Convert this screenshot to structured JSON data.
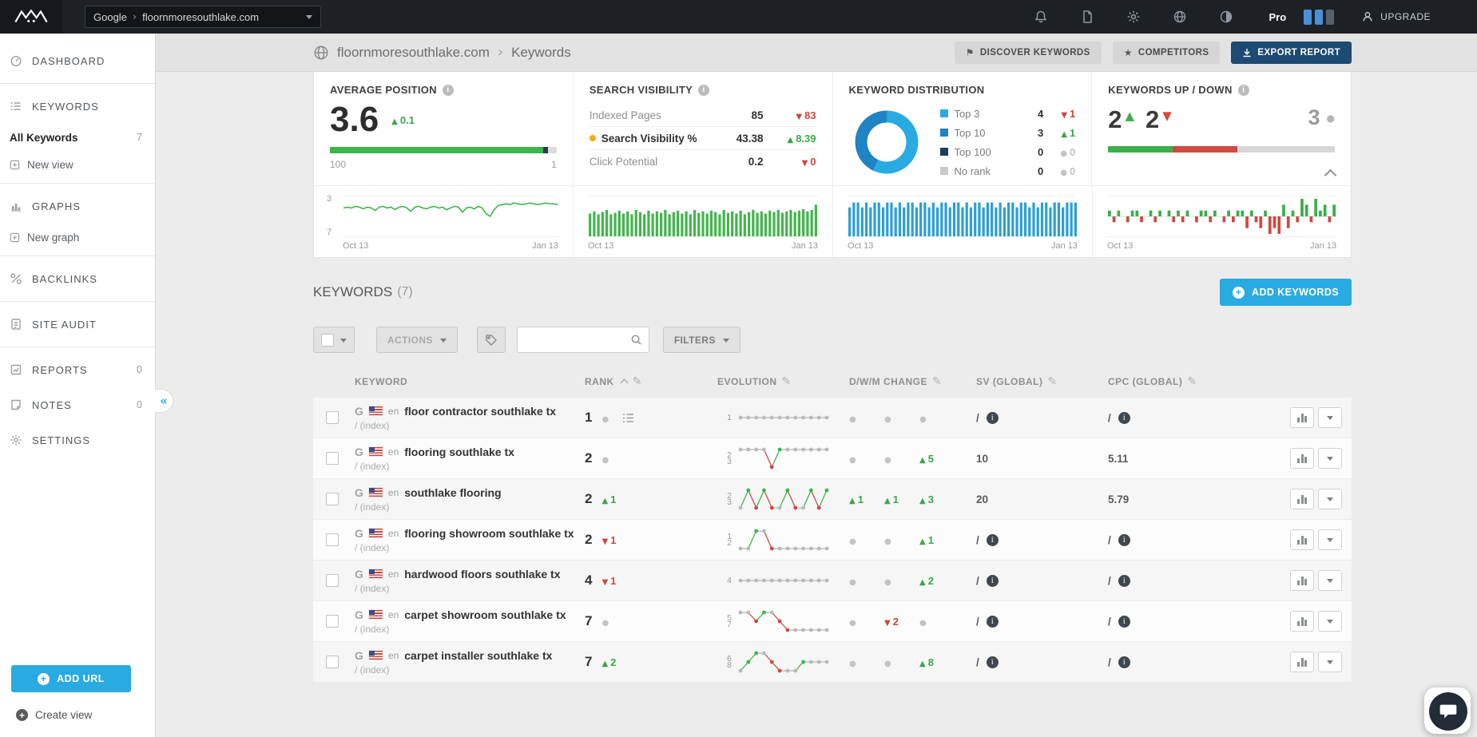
{
  "topbar": {
    "selector_prefix": "Google",
    "selector_separator": "›",
    "selector_site": "floornmoresouthlake.com",
    "plan": "Pro",
    "upgrade": "UPGRADE"
  },
  "sidebar": {
    "dashboard": "DASHBOARD",
    "keywords": "KEYWORDS",
    "all_keywords": "All Keywords",
    "all_keywords_count": "7",
    "new_view": "New view",
    "graphs": "GRAPHS",
    "new_graph": "New graph",
    "backlinks": "BACKLINKS",
    "site_audit": "SITE AUDIT",
    "reports": "REPORTS",
    "reports_count": "0",
    "notes": "NOTES",
    "notes_count": "0",
    "settings": "SETTINGS",
    "collapse": "«",
    "add_url": "ADD URL",
    "create_view": "Create view"
  },
  "header": {
    "site": "floornmoresouthlake.com",
    "separator": "›",
    "section": "Keywords",
    "discover": "DISCOVER KEYWORDS",
    "competitors": "COMPETITORS",
    "export": "EXPORT REPORT"
  },
  "stats": {
    "avg_position": {
      "title": "AVERAGE POSITION",
      "value": "3.6",
      "change_dir": "up",
      "change": "0.1",
      "bar_pct": 94,
      "scale_left": "100",
      "scale_right": "1"
    },
    "search_visibility": {
      "title": "SEARCH VISIBILITY",
      "rows": [
        {
          "label": "Indexed Pages",
          "value": "85",
          "dir": "down",
          "change": "83",
          "active": false
        },
        {
          "label": "Search Visibility %",
          "value": "43.38",
          "dir": "up",
          "change": "8.39",
          "active": true
        },
        {
          "label": "Click Potential",
          "value": "0.2",
          "dir": "down",
          "change": "0",
          "active": false
        }
      ]
    },
    "distribution": {
      "title": "KEYWORD DISTRIBUTION",
      "legend": [
        {
          "label": "Top 3",
          "value": "4",
          "dir": "down",
          "change": "1",
          "color": "#29abe2"
        },
        {
          "label": "Top 10",
          "value": "3",
          "dir": "up",
          "change": "1",
          "color": "#1f83c4"
        },
        {
          "label": "Top 100",
          "value": "0",
          "dir": "none",
          "change": "0",
          "color": "#1d4057"
        },
        {
          "label": "No rank",
          "value": "0",
          "dir": "none",
          "change": "0",
          "color": "#c9c9c9"
        }
      ]
    },
    "updown": {
      "title": "KEYWORDS UP / DOWN",
      "up_count": "2",
      "down_count": "2",
      "same_count": "3",
      "bar_up_pct": 28.5,
      "bar_down_pct": 28.5
    }
  },
  "charts": {
    "avg_position_spark": {
      "type": "line",
      "label_top": "3",
      "label_bottom": "7",
      "x_start": "Oct 13",
      "x_end": "Jan 13",
      "min": 3,
      "max": 7,
      "color": "#3cb54a",
      "values": [
        4.0,
        3.9,
        4.0,
        3.8,
        3.9,
        4.1,
        3.9,
        4.0,
        4.3,
        3.9,
        3.8,
        4.0,
        3.9,
        4.2,
        3.9,
        3.8,
        4.0,
        4.4,
        3.9,
        3.8,
        4.0,
        4.1,
        3.9,
        3.8,
        4.0,
        3.9,
        4.2,
        4.0,
        3.8,
        3.9,
        4.5,
        4.0,
        3.9,
        4.1,
        3.8,
        4.0,
        4.7,
        5.0,
        4.2,
        3.7,
        3.6,
        3.5,
        3.6,
        3.4,
        3.5,
        3.6,
        3.5,
        3.4,
        3.5,
        3.6,
        3.5,
        3.4,
        3.5,
        3.5,
        3.6
      ]
    },
    "visibility_spark": {
      "type": "bar",
      "x_start": "Oct 13",
      "x_end": "Jan 13",
      "max": 50,
      "color": "#44b54e",
      "values": [
        31,
        34,
        30,
        33,
        36,
        30,
        32,
        35,
        31,
        34,
        30,
        36,
        33,
        30,
        35,
        31,
        34,
        32,
        36,
        30,
        33,
        35,
        31,
        34,
        30,
        36,
        32,
        34,
        31,
        35,
        33,
        30,
        36,
        32,
        34,
        31,
        35,
        30,
        33,
        36,
        32,
        34,
        31,
        35,
        33,
        36,
        32,
        34,
        36,
        33,
        35,
        37,
        34,
        36,
        43
      ]
    },
    "distribution_spark": {
      "type": "bar",
      "x_start": "Oct 13",
      "x_end": "Jan 13",
      "max": 7.6,
      "color": "#2d9fd6",
      "values": [
        6,
        7,
        7,
        6,
        7,
        6,
        7,
        7,
        6,
        7,
        7,
        6,
        7,
        6,
        7,
        7,
        6,
        7,
        7,
        6,
        7,
        6,
        7,
        7,
        6,
        7,
        7,
        6,
        7,
        6,
        7,
        7,
        6,
        7,
        7,
        6,
        7,
        6,
        7,
        7,
        6,
        7,
        7,
        6,
        7,
        6,
        7,
        7,
        6,
        7,
        7,
        6,
        7,
        7,
        7
      ]
    },
    "updown_spark": {
      "type": "bar",
      "x_start": "Oct 13",
      "x_end": "Jan 13",
      "max": 3,
      "color_up": "#3aaf4c",
      "color_down": "#cf4a40",
      "values": [
        1,
        -1,
        1,
        0,
        -1,
        1,
        1,
        -1,
        0,
        1,
        -1,
        1,
        0,
        1,
        -1,
        1,
        -1,
        1,
        0,
        -1,
        1,
        1,
        -1,
        1,
        0,
        -1,
        1,
        -1,
        1,
        1,
        -2,
        1,
        -1,
        -2,
        1,
        -3,
        -2,
        -3,
        2,
        -2,
        1,
        -1,
        3,
        2,
        -1,
        3,
        1,
        2,
        -1,
        2
      ]
    }
  },
  "keywords_section": {
    "title": "KEYWORDS",
    "count": "(7)",
    "add_button": "ADD KEYWORDS",
    "actions": "ACTIONS",
    "filters": "FILTERS",
    "search_placeholder": ""
  },
  "table": {
    "headers": {
      "keyword": "KEYWORD",
      "rank": "RANK",
      "evolution": "EVOLUTION",
      "dwm": "D/W/M CHANGE",
      "sv": "SV (GLOBAL)",
      "cpc": "CPC (GLOBAL)"
    },
    "rows": [
      {
        "engine": "G",
        "lang": "en",
        "keyword": "floor contractor southlake tx",
        "path": "/ (index)",
        "rank": "1",
        "rank_dir": "none",
        "rank_change": "",
        "serp_icon": true,
        "evo": {
          "label_top": "",
          "label_mid": "1",
          "label_bottom": "",
          "values": [
            1,
            1,
            1,
            1,
            1,
            1,
            1,
            1,
            1,
            1,
            1,
            1
          ]
        },
        "dwm": [
          {
            "dir": "none",
            "value": ""
          },
          {
            "dir": "none",
            "value": ""
          },
          {
            "dir": "none",
            "value": ""
          }
        ],
        "sv": "/",
        "sv_info": true,
        "cpc": "/",
        "cpc_info": true
      },
      {
        "engine": "G",
        "lang": "en",
        "keyword": "flooring southlake tx",
        "path": "/ (index)",
        "rank": "2",
        "rank_dir": "none",
        "rank_change": "",
        "serp_icon": false,
        "evo": {
          "label_top": "2",
          "label_mid": "",
          "label_bottom": "3",
          "values": [
            2,
            2,
            2,
            2,
            3,
            2,
            2,
            2,
            2,
            2,
            2,
            2
          ]
        },
        "dwm": [
          {
            "dir": "none",
            "value": ""
          },
          {
            "dir": "none",
            "value": ""
          },
          {
            "dir": "up",
            "value": "5"
          }
        ],
        "sv": "10",
        "sv_info": false,
        "cpc": "5.11",
        "cpc_info": false
      },
      {
        "engine": "G",
        "lang": "en",
        "keyword": "southlake flooring",
        "path": "/ (index)",
        "rank": "2",
        "rank_dir": "up",
        "rank_change": "1",
        "serp_icon": false,
        "evo": {
          "label_top": "2",
          "label_mid": "",
          "label_bottom": "3",
          "values": [
            3,
            2,
            3,
            2,
            3,
            3,
            2,
            3,
            3,
            2,
            3,
            2
          ]
        },
        "dwm": [
          {
            "dir": "up",
            "value": "1"
          },
          {
            "dir": "up",
            "value": "1"
          },
          {
            "dir": "up",
            "value": "3"
          }
        ],
        "sv": "20",
        "sv_info": false,
        "cpc": "5.79",
        "cpc_info": false
      },
      {
        "engine": "G",
        "lang": "en",
        "keyword": "flooring showroom southlake tx",
        "path": "/ (index)",
        "rank": "2",
        "rank_dir": "down",
        "rank_change": "1",
        "serp_icon": false,
        "evo": {
          "label_top": "1",
          "label_mid": "",
          "label_bottom": "2",
          "values": [
            2,
            2,
            1,
            1,
            2,
            2,
            2,
            2,
            2,
            2,
            2,
            2
          ]
        },
        "dwm": [
          {
            "dir": "none",
            "value": ""
          },
          {
            "dir": "none",
            "value": ""
          },
          {
            "dir": "up",
            "value": "1"
          }
        ],
        "sv": "/",
        "sv_info": true,
        "cpc": "/",
        "cpc_info": true
      },
      {
        "engine": "G",
        "lang": "en",
        "keyword": "hardwood floors southlake tx",
        "path": "/ (index)",
        "rank": "4",
        "rank_dir": "down",
        "rank_change": "1",
        "serp_icon": false,
        "evo": {
          "label_top": "",
          "label_mid": "4",
          "label_bottom": "",
          "values": [
            4,
            4,
            4,
            4,
            4,
            4,
            4,
            4,
            4,
            4,
            4,
            4
          ]
        },
        "dwm": [
          {
            "dir": "none",
            "value": ""
          },
          {
            "dir": "none",
            "value": ""
          },
          {
            "dir": "up",
            "value": "2"
          }
        ],
        "sv": "/",
        "sv_info": true,
        "cpc": "/",
        "cpc_info": true
      },
      {
        "engine": "G",
        "lang": "en",
        "keyword": "carpet showroom southlake tx",
        "path": "/ (index)",
        "rank": "7",
        "rank_dir": "none",
        "rank_change": "",
        "serp_icon": false,
        "evo": {
          "label_top": "5",
          "label_mid": "",
          "label_bottom": "7",
          "values": [
            5,
            5,
            6,
            5,
            5,
            6,
            7,
            7,
            7,
            7,
            7,
            7
          ]
        },
        "dwm": [
          {
            "dir": "none",
            "value": ""
          },
          {
            "dir": "down",
            "value": "2"
          },
          {
            "dir": "none",
            "value": ""
          }
        ],
        "sv": "/",
        "sv_info": true,
        "cpc": "/",
        "cpc_info": true
      },
      {
        "engine": "G",
        "lang": "en",
        "keyword": "carpet installer southlake tx",
        "path": "/ (index)",
        "rank": "7",
        "rank_dir": "up",
        "rank_change": "2",
        "serp_icon": false,
        "evo": {
          "label_top": "6",
          "label_mid": "",
          "label_bottom": "8",
          "values": [
            8,
            7,
            6,
            6,
            7,
            8,
            8,
            8,
            7,
            7,
            7,
            7
          ]
        },
        "dwm": [
          {
            "dir": "none",
            "value": ""
          },
          {
            "dir": "none",
            "value": ""
          },
          {
            "dir": "up",
            "value": "8"
          }
        ],
        "sv": "/",
        "sv_info": true,
        "cpc": "/",
        "cpc_info": true
      }
    ]
  }
}
